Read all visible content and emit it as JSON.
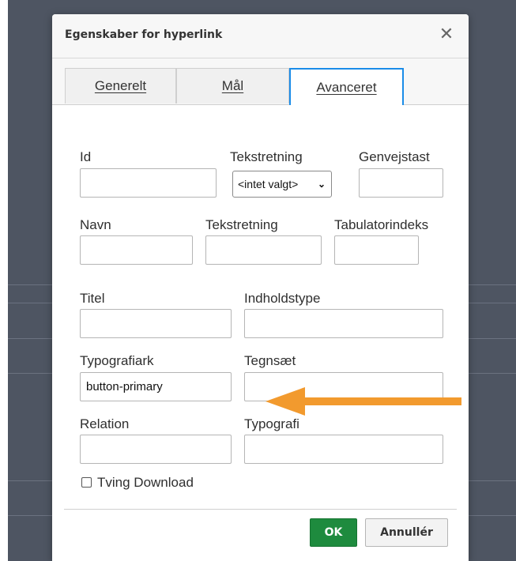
{
  "dialog": {
    "title": "Egenskaber for hyperlink",
    "close_symbol": "✕"
  },
  "tabs": [
    {
      "label": "Generelt",
      "active": false
    },
    {
      "label": "Mål",
      "active": false
    },
    {
      "label": "Avanceret",
      "active": true
    }
  ],
  "fields": {
    "id": {
      "label": "Id",
      "value": ""
    },
    "text_direction_1": {
      "label": "Tekstretning",
      "selected": "<intet valgt>"
    },
    "access_key": {
      "label": "Genvejstast",
      "value": ""
    },
    "name": {
      "label": "Navn",
      "value": ""
    },
    "text_direction_2": {
      "label": "Tekstretning",
      "value": ""
    },
    "tab_index": {
      "label": "Tabulatorindeks",
      "value": ""
    },
    "title": {
      "label": "Titel",
      "value": ""
    },
    "content_type": {
      "label": "Indholdstype",
      "value": ""
    },
    "stylesheet": {
      "label": "Typografiark",
      "value": "button-primary"
    },
    "charset": {
      "label": "Tegnsæt",
      "value": ""
    },
    "relation": {
      "label": "Relation",
      "value": ""
    },
    "style": {
      "label": "Typografi",
      "value": ""
    }
  },
  "force_download": {
    "label": "Tving Download",
    "checked": false
  },
  "buttons": {
    "ok": "OK",
    "cancel": "Annullér"
  },
  "icons": {
    "close": "close-icon",
    "chevron": "chevron-down-icon",
    "annotation": "arrow-left-icon"
  },
  "colors": {
    "accent": "#1a8ce8",
    "ok": "#1e8b3e",
    "annotation_arrow": "#f29a2e",
    "backdrop": "#4e5562"
  }
}
